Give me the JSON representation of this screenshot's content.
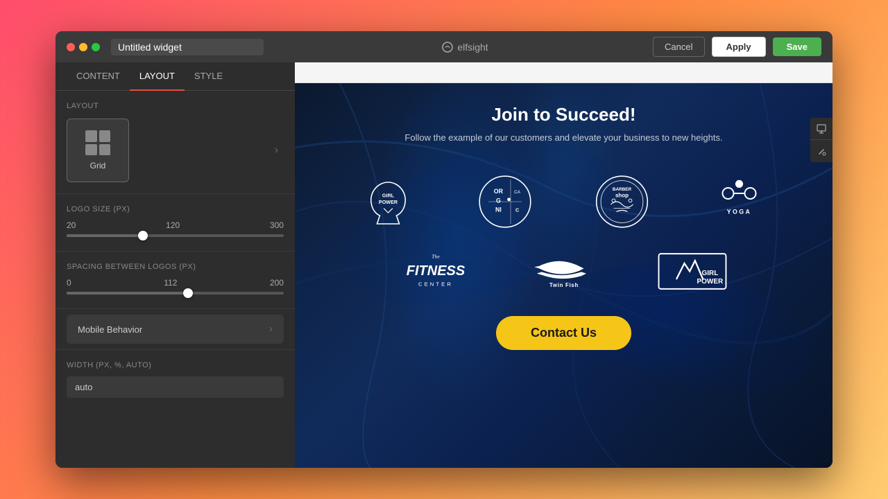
{
  "window": {
    "traffic_lights": [
      "red",
      "yellow",
      "green"
    ],
    "title": "Untitled widget"
  },
  "header": {
    "logo_text": "elfsight",
    "cancel_label": "Cancel",
    "apply_label": "Apply",
    "save_label": "Save"
  },
  "sidebar": {
    "tabs": [
      {
        "id": "content",
        "label": "CONTENT",
        "active": false
      },
      {
        "id": "layout",
        "label": "LAYOUT",
        "active": true
      },
      {
        "id": "style",
        "label": "STYLE",
        "active": false
      }
    ],
    "layout_section": {
      "label": "LAYOUT",
      "selected": "Grid",
      "options": [
        {
          "label": "Grid"
        }
      ]
    },
    "logo_size": {
      "label": "LOGO SIZE (PX)",
      "min": 20,
      "max": 300,
      "value": 120,
      "thumb_pct": 35
    },
    "spacing": {
      "label": "SPACING BETWEEN LOGOS (PX)",
      "min": 0,
      "max": 200,
      "value": 112,
      "thumb_pct": 56
    },
    "mobile_behavior": {
      "label": "Mobile Behavior"
    },
    "width": {
      "label": "WIDTH (PX, %, AUTO)",
      "value": "auto"
    }
  },
  "preview": {
    "title": "Join to Succeed!",
    "subtitle": "Follow the example of our customers and elevate your business to new heights.",
    "contact_btn": "Contact Us",
    "logos_row1": [
      {
        "id": "girl-power",
        "alt": "Girl Power"
      },
      {
        "id": "organic-cafe",
        "alt": "Organic Cafe"
      },
      {
        "id": "barber-shop",
        "alt": "Barber Shop"
      },
      {
        "id": "yoga",
        "alt": "Yoga"
      }
    ],
    "logos_row2": [
      {
        "id": "fitness-center",
        "alt": "The Fitness Center"
      },
      {
        "id": "twin-fish",
        "alt": "Twin Fish"
      },
      {
        "id": "girl-power-2",
        "alt": "Girl Power 2"
      }
    ]
  }
}
